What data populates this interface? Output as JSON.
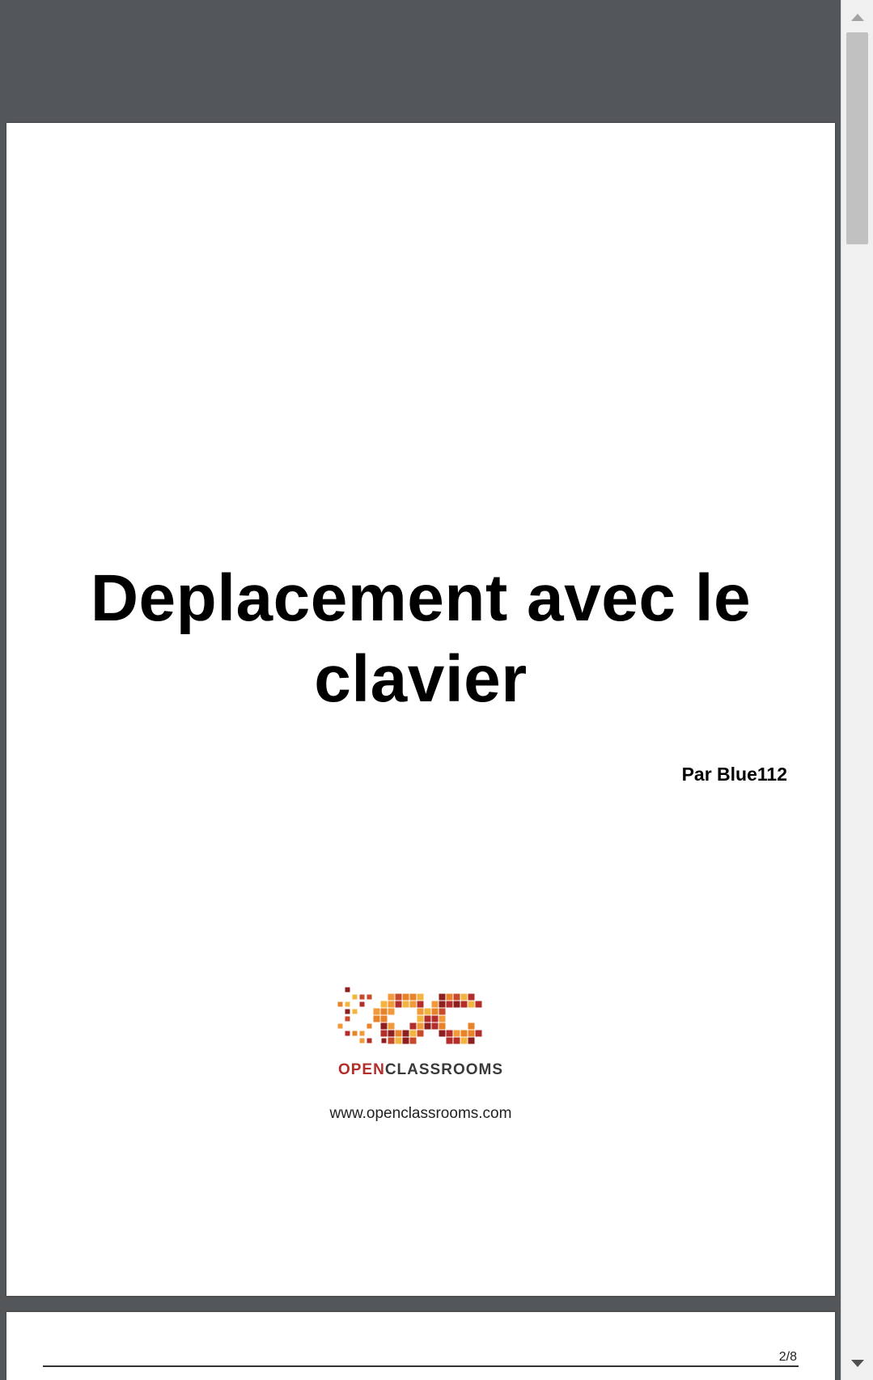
{
  "document": {
    "title": "Deplacement avec le clavier",
    "author": "Par Blue112",
    "logo": {
      "open": "OPEN",
      "classrooms": "CLASSROOMS",
      "monogram": "OC"
    },
    "site_url": "www.openclassrooms.com"
  },
  "page2": {
    "page_number": "2/8"
  },
  "colors": {
    "viewer_background": "#54575a",
    "page": "#ffffff",
    "logo_red": "#b32d2a",
    "logo_orange": "#e8832a",
    "logo_yellow": "#f2b640",
    "scrollbar_track": "#f0f0f0",
    "scrollbar_thumb": "#c1c1c1"
  },
  "icons": {
    "scroll_up": "triangle-up-icon",
    "scroll_down": "triangle-down-icon"
  }
}
